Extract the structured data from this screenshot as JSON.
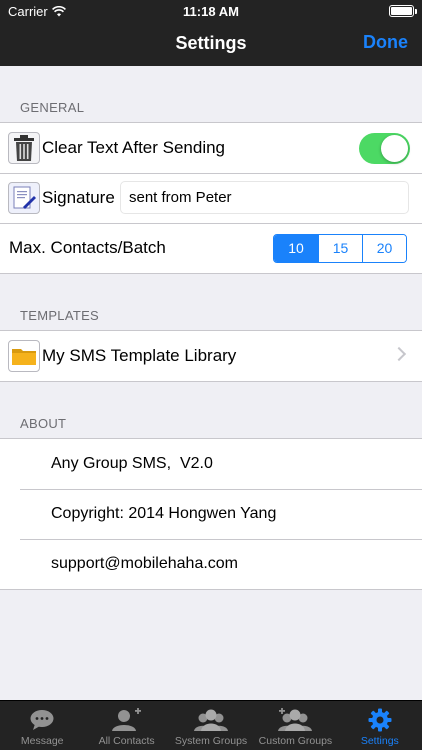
{
  "status_bar": {
    "carrier": "Carrier",
    "time": "11:18 AM"
  },
  "nav": {
    "title": "Settings",
    "done_label": "Done"
  },
  "general": {
    "header": "GENERAL",
    "clear_text_label": "Clear Text After Sending",
    "clear_text_on": true,
    "signature_label": "Signature",
    "signature_value": "sent from Peter",
    "max_contacts_label": "Max. Contacts/Batch",
    "batch_options": [
      "10",
      "15",
      "20"
    ],
    "batch_selected": "10"
  },
  "templates": {
    "header": "TEMPLATES",
    "library_label": "My SMS Template Library"
  },
  "about": {
    "header": "ABOUT",
    "app_version": "Any Group SMS,  V2.0",
    "copyright": "Copyright: 2014 Hongwen Yang",
    "email": "support@mobilehaha.com"
  },
  "tabbar": {
    "tabs": [
      {
        "label": "Message",
        "icon": "message-icon"
      },
      {
        "label": "All Contacts",
        "icon": "add-contact-icon"
      },
      {
        "label": "System Groups",
        "icon": "group-icon"
      },
      {
        "label": "Custom Groups",
        "icon": "add-group-icon"
      },
      {
        "label": "Settings",
        "icon": "gear-icon"
      }
    ],
    "active": "Settings"
  },
  "colors": {
    "accent": "#1a82fb",
    "toggle_on": "#4cd964",
    "bar": "#232323"
  }
}
